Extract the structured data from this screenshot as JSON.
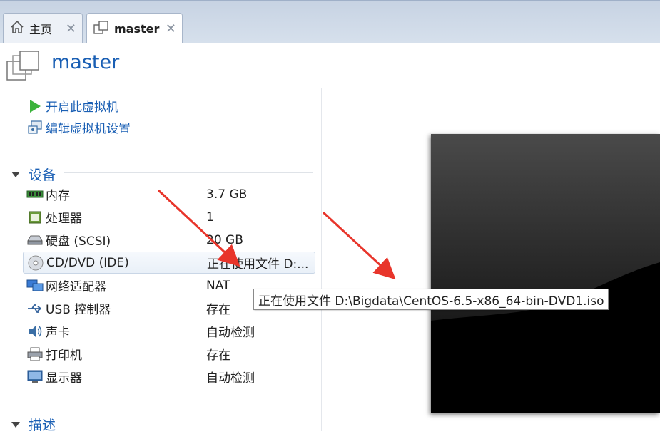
{
  "tabs": [
    {
      "label": "主页",
      "icon": "home-icon",
      "active": false
    },
    {
      "label": "master",
      "icon": "vm-icon",
      "active": true
    }
  ],
  "header": {
    "title": "master"
  },
  "actions": [
    {
      "label": "开启此虚拟机",
      "icon": "play-icon"
    },
    {
      "label": "编辑虚拟机设置",
      "icon": "settings-icon"
    }
  ],
  "devices_section": {
    "label": "设备"
  },
  "devices": [
    {
      "name": "内存",
      "value": "3.7 GB",
      "icon": "memory-icon"
    },
    {
      "name": "处理器",
      "value": "1",
      "icon": "processor-icon"
    },
    {
      "name": "硬盘 (SCSI)",
      "value": "20 GB",
      "icon": "harddisk-icon"
    },
    {
      "name": "CD/DVD (IDE)",
      "value": "正在使用文件 D:...",
      "icon": "cd-dvd-icon",
      "selected": true
    },
    {
      "name": "网络适配器",
      "value": "NAT",
      "icon": "network-icon"
    },
    {
      "name": "USB 控制器",
      "value": "存在",
      "icon": "usb-icon"
    },
    {
      "name": "声卡",
      "value": "自动检测",
      "icon": "sound-icon"
    },
    {
      "name": "打印机",
      "value": "存在",
      "icon": "printer-icon"
    },
    {
      "name": "显示器",
      "value": "自动检测",
      "icon": "display-icon"
    }
  ],
  "tooltip": {
    "text": "正在使用文件 D:\\Bigdata\\CentOS-6.5-x86_64-bin-DVD1.iso"
  },
  "description_section": {
    "label": "描述"
  },
  "colors": {
    "accent": "#1a5fb4",
    "annotation_arrow": "#e8352b"
  }
}
